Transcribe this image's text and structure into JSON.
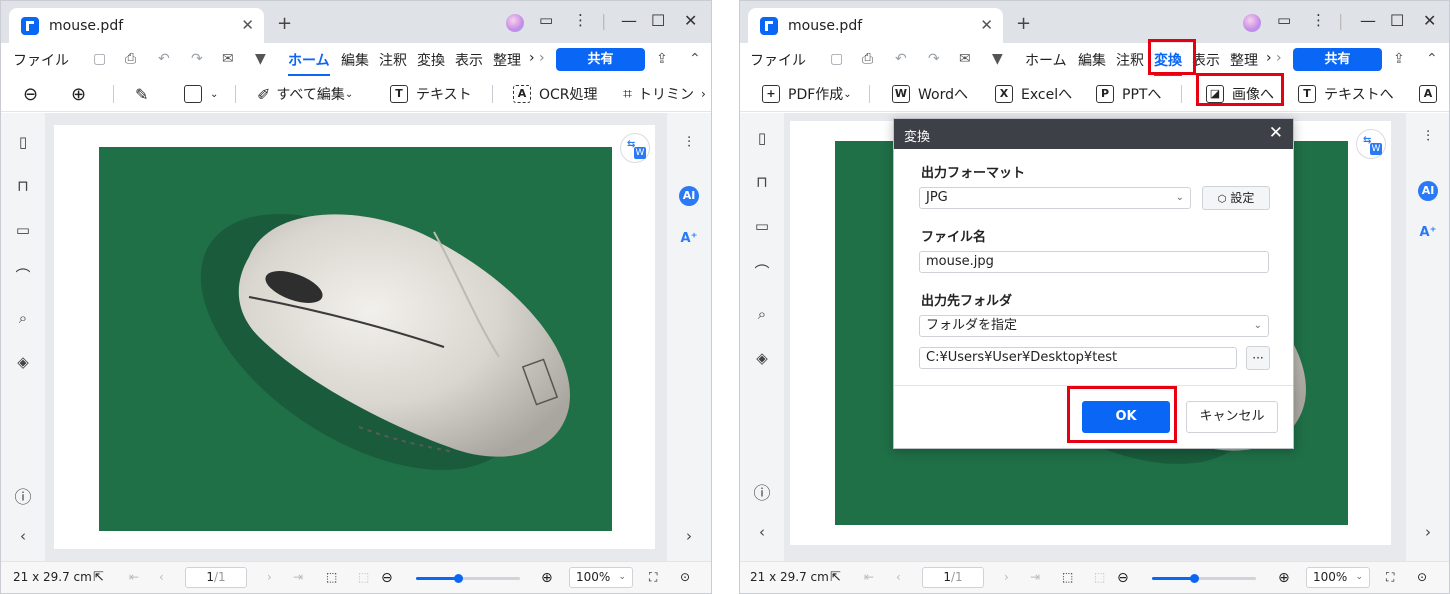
{
  "left": {
    "tab": {
      "title": "mouse.pdf"
    },
    "menu": [
      "ファイル",
      "ホーム",
      "編集",
      "注釈",
      "変換",
      "表示",
      "整理"
    ],
    "share_label": "共有",
    "toolbar": {
      "edit_all": "すべて編集",
      "text": "テキスト",
      "ocr": "OCR処理",
      "trim": "トリミン"
    },
    "status": {
      "size": "21 x 29.7 cm",
      "page": "1",
      "total": "/1",
      "zoom": "100%"
    }
  },
  "right": {
    "tab": {
      "title": "mouse.pdf"
    },
    "menu": [
      "ファイル",
      "ホーム",
      "編集",
      "注釈",
      "変換",
      "表示",
      "整理"
    ],
    "share_label": "共有",
    "toolbar": {
      "pdf_create": "PDF作成",
      "word": "Wordへ",
      "excel": "Excelへ",
      "ppt": "PPTへ",
      "image": "画像へ",
      "text": "テキストへ"
    },
    "status": {
      "size": "21 x 29.7 cm",
      "page": "1",
      "total": "/1",
      "zoom": "100%"
    },
    "dialog": {
      "title": "変換",
      "format_label": "出力フォーマット",
      "format_value": "JPG",
      "settings_label": "設定",
      "filename_label": "ファイル名",
      "filename_value": "mouse.jpg",
      "folder_label": "出力先フォルダ",
      "folder_option": "フォルダを指定",
      "folder_path": "C:¥Users¥User¥Desktop¥test",
      "browse_label": "···",
      "ok_label": "OK",
      "cancel_label": "キャンセル"
    }
  },
  "colors": {
    "accent": "#0a66f5",
    "highlight": "#e60012",
    "photo_bg": "#1f6f47"
  },
  "icons": [
    "zoom-out-icon",
    "zoom-in-icon",
    "highlighter-icon",
    "rectangle-icon",
    "ai-icon",
    "translate-icon",
    "search-icon",
    "bookmark-icon",
    "comment-icon",
    "attachment-icon",
    "layers-icon",
    "help-icon"
  ]
}
